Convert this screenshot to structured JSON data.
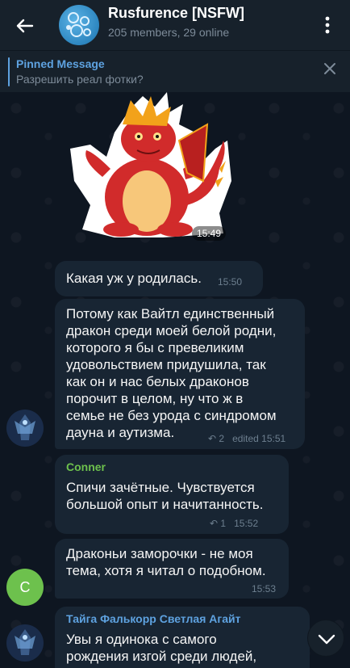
{
  "header": {
    "back_icon": "arrow-left-icon",
    "title": "Rusfurence [NSFW]",
    "subtitle": "205 members, 29 online",
    "menu_icon": "kebab-menu-icon"
  },
  "pinned": {
    "title": "Pinned Message",
    "text": "Разрешить реал фотки?",
    "close_icon": "close-icon"
  },
  "messages": [
    {
      "type": "sticker",
      "time": "15:49"
    },
    {
      "type": "text",
      "text": "Какая уж у родилась.",
      "time": "15:50"
    },
    {
      "type": "text",
      "lines": [
        "Потому как Вайтл единственный",
        "дракон среди моей белой родни,",
        "которого я бы с превеликим",
        "удовольствием придушила, так",
        "как он и нас белых драконов",
        "порочит в целом, ну что ж в",
        "семье не без урода с синдромом",
        "дауна и аутизма."
      ],
      "replies": "2",
      "meta": "edited 15:51"
    },
    {
      "type": "text",
      "sender": "Conner",
      "sender_color": "#6dc14d",
      "lines": [
        "Спичи зачётные. Чувствуется",
        "большой опыт и начитанность."
      ],
      "replies": "1",
      "time": "15:52"
    },
    {
      "type": "text",
      "lines": [
        "Драконьи заморочки - не моя",
        "тема, хотя я читал о подобном."
      ],
      "time": "15:53",
      "avatar_letter": "C"
    },
    {
      "type": "text",
      "sender": "Тайга Фалькорр Светлая Агайт",
      "sender_color": "#5ea2e0",
      "lines": [
        "Увы я одинока с самого",
        "рождения изгой среди людей,"
      ]
    }
  ],
  "colors": {
    "background": "#0e1621",
    "header": "#17212b",
    "bubble": "#182533",
    "accent": "#5ea2e0"
  }
}
